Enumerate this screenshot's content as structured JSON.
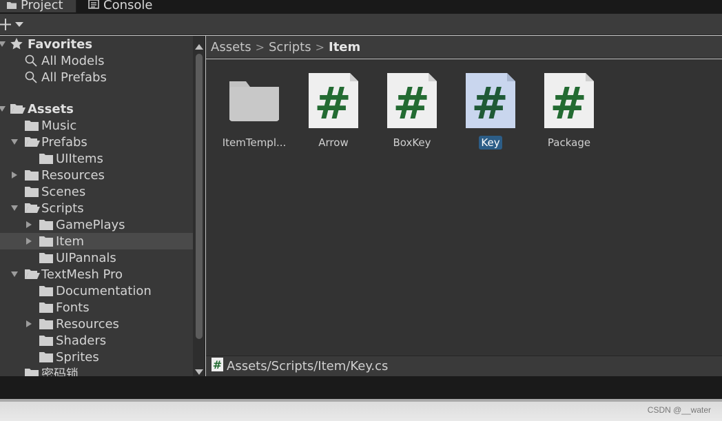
{
  "tabs": [
    {
      "label": "Project",
      "icon": "folder-icon"
    },
    {
      "label": "Console",
      "icon": "console-icon"
    }
  ],
  "toolbar": {
    "add_icon": "plus-icon",
    "dropdown_icon": "chevron-down-icon"
  },
  "tree": {
    "favorites": {
      "label": "Favorites",
      "items": [
        {
          "label": "All Models",
          "icon": "search-icon"
        },
        {
          "label": "All Prefabs",
          "icon": "search-icon"
        }
      ]
    },
    "assets": {
      "label": "Assets",
      "items": [
        {
          "label": "Music"
        },
        {
          "label": "Prefabs"
        },
        {
          "label": "UIItems"
        },
        {
          "label": "Resources"
        },
        {
          "label": "Scenes"
        },
        {
          "label": "Scripts"
        },
        {
          "label": "GamePlays"
        },
        {
          "label": "Item"
        },
        {
          "label": "UIPannals"
        },
        {
          "label": "TextMesh Pro"
        },
        {
          "label": "Documentation"
        },
        {
          "label": "Fonts"
        },
        {
          "label": "Resources"
        },
        {
          "label": "Shaders"
        },
        {
          "label": "Sprites"
        },
        {
          "label": "密码锁"
        }
      ]
    }
  },
  "breadcrumb": {
    "items": [
      "Assets",
      "Scripts",
      "Item"
    ],
    "separator": ">"
  },
  "assets_grid": [
    {
      "name": "ItemTempl...",
      "kind": "folder"
    },
    {
      "name": "Arrow",
      "kind": "script"
    },
    {
      "name": "BoxKey",
      "kind": "script"
    },
    {
      "name": "Key",
      "kind": "script",
      "selected": true
    },
    {
      "name": "Package",
      "kind": "script"
    }
  ],
  "path_bar": {
    "path": "Assets/Scripts/Item/Key.cs"
  },
  "watermark": "CSDN @__water",
  "colors": {
    "selection": "#2c5d87",
    "script_green": "#236b32",
    "panel_bg": "#383838",
    "grid_bg": "#333333"
  }
}
